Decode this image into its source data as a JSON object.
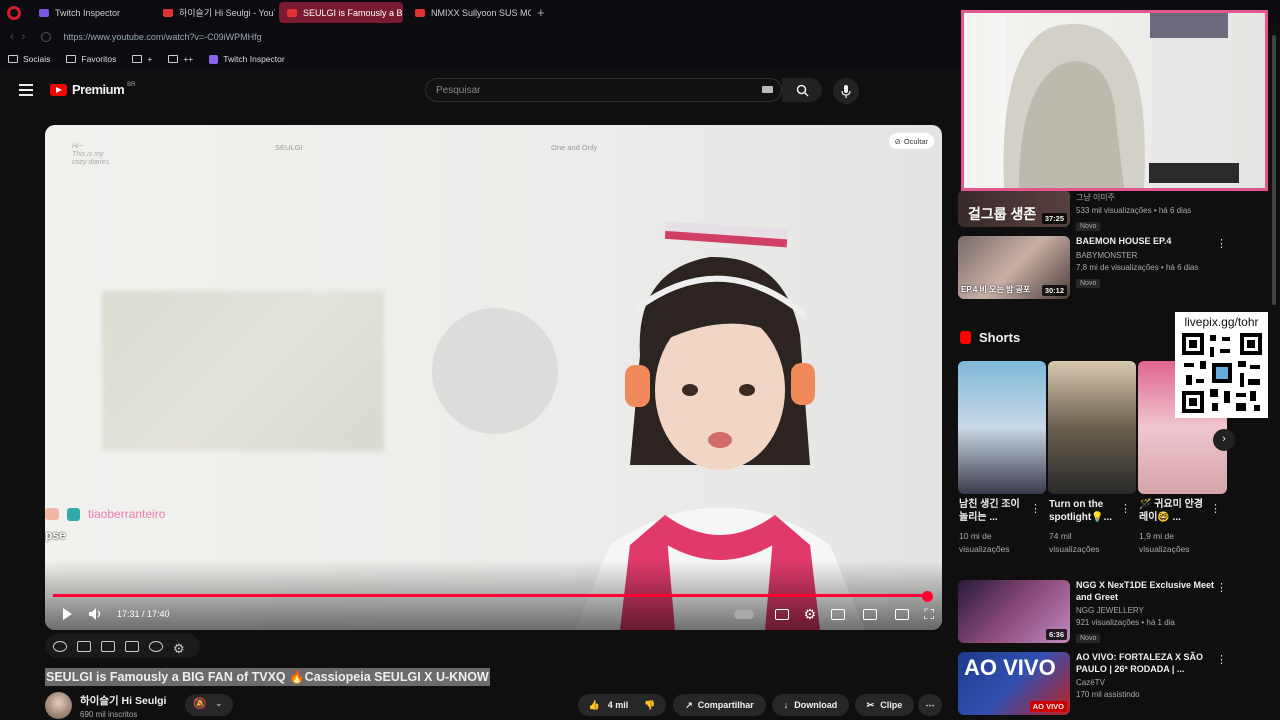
{
  "browser": {
    "tabs": [
      {
        "label": "Twitch Inspector",
        "icon": "twitch-icon",
        "active": false
      },
      {
        "label": "하이슬기 Hi Seulgi - YouT",
        "icon": "youtube-icon",
        "active": false
      },
      {
        "label": "SEULGI is Famously a BIG",
        "icon": "youtube-icon",
        "active": true
      },
      {
        "label": "NMIXX Sullyoon SUS MO",
        "icon": "youtube-icon",
        "active": false
      }
    ],
    "new_tab": "+",
    "url": "https://www.youtube.com/watch?v=-C09iWPMHfg",
    "bookmarks": [
      "Sociais",
      "Favoritos",
      "+",
      "++",
      "Twitch Inspector"
    ]
  },
  "youtube": {
    "logo": "Premium",
    "country": "BR",
    "search_placeholder": "Pesquisar"
  },
  "video": {
    "overlay_hi": "Hi~\nThis is my\ncozy diaries.",
    "overlay_seulgi": "SEULGI",
    "overlay_one": "One and Only",
    "hide_label": "Ocultar",
    "time": "17:31 / 17:40",
    "progress": 0.992,
    "chat_user": "tiaoberranteiro",
    "chat_text": "pse",
    "title": "SEULGI is Famously a BIG FAN of TVXQ 🔥Cassiopeia SEULGI X U-KNOW",
    "channel": "하이슬기 Hi Seulgi",
    "subscribers": "690 mil inscritos",
    "likes": "4 mil",
    "share": "Compartilhar",
    "download": "Download",
    "clip": "Clipe"
  },
  "sidebar": {
    "videos": [
      {
        "title_partial": "그냥 이미주",
        "views": "533 mil visualizações • há 6 dias",
        "badge": "Novo",
        "duration": "37:25",
        "thumb_text": "걸그룹 생존"
      },
      {
        "title": "BAEMON HOUSE EP.4",
        "channel": "BABYMONSTER",
        "views": "7,8 mi de visualizações • há 6 dias",
        "badge": "Novo",
        "duration": "30:12",
        "thumb_text": "EP.4 비 오는 밤 공포"
      },
      {
        "title": "NGG X NexT1DE Exclusive Meet and Greet",
        "channel": "NGG JEWELLERY",
        "views": "921 visualizações • há 1 dia",
        "badge": "Novo",
        "duration": "6:36"
      },
      {
        "title": "AO VIVO: FORTALEZA X SÃO PAULO | 26ª RODADA | ...",
        "channel": "CazéTV",
        "views": "170 mil assistindo",
        "thumb_text": "AO VIVO",
        "live_badge": "AO VIVO"
      }
    ],
    "shorts_heading": "Shorts",
    "shorts": [
      {
        "title": "남친 생긴 조이 놀리는 ...",
        "views": "10 mi de visualizações"
      },
      {
        "title": "Turn on the spotlight💡...",
        "views": "74 mil visualizações"
      },
      {
        "title": "🪄 귀요미 안경레이🤓 ...",
        "views": "1,9 mi de visualizações"
      }
    ]
  },
  "overlay": {
    "qr_text": "livepix.gg/tohr"
  },
  "colors": {
    "accent": "#ff0033",
    "tab_active": "#7a1a31",
    "webcam_border": "#e35690"
  }
}
